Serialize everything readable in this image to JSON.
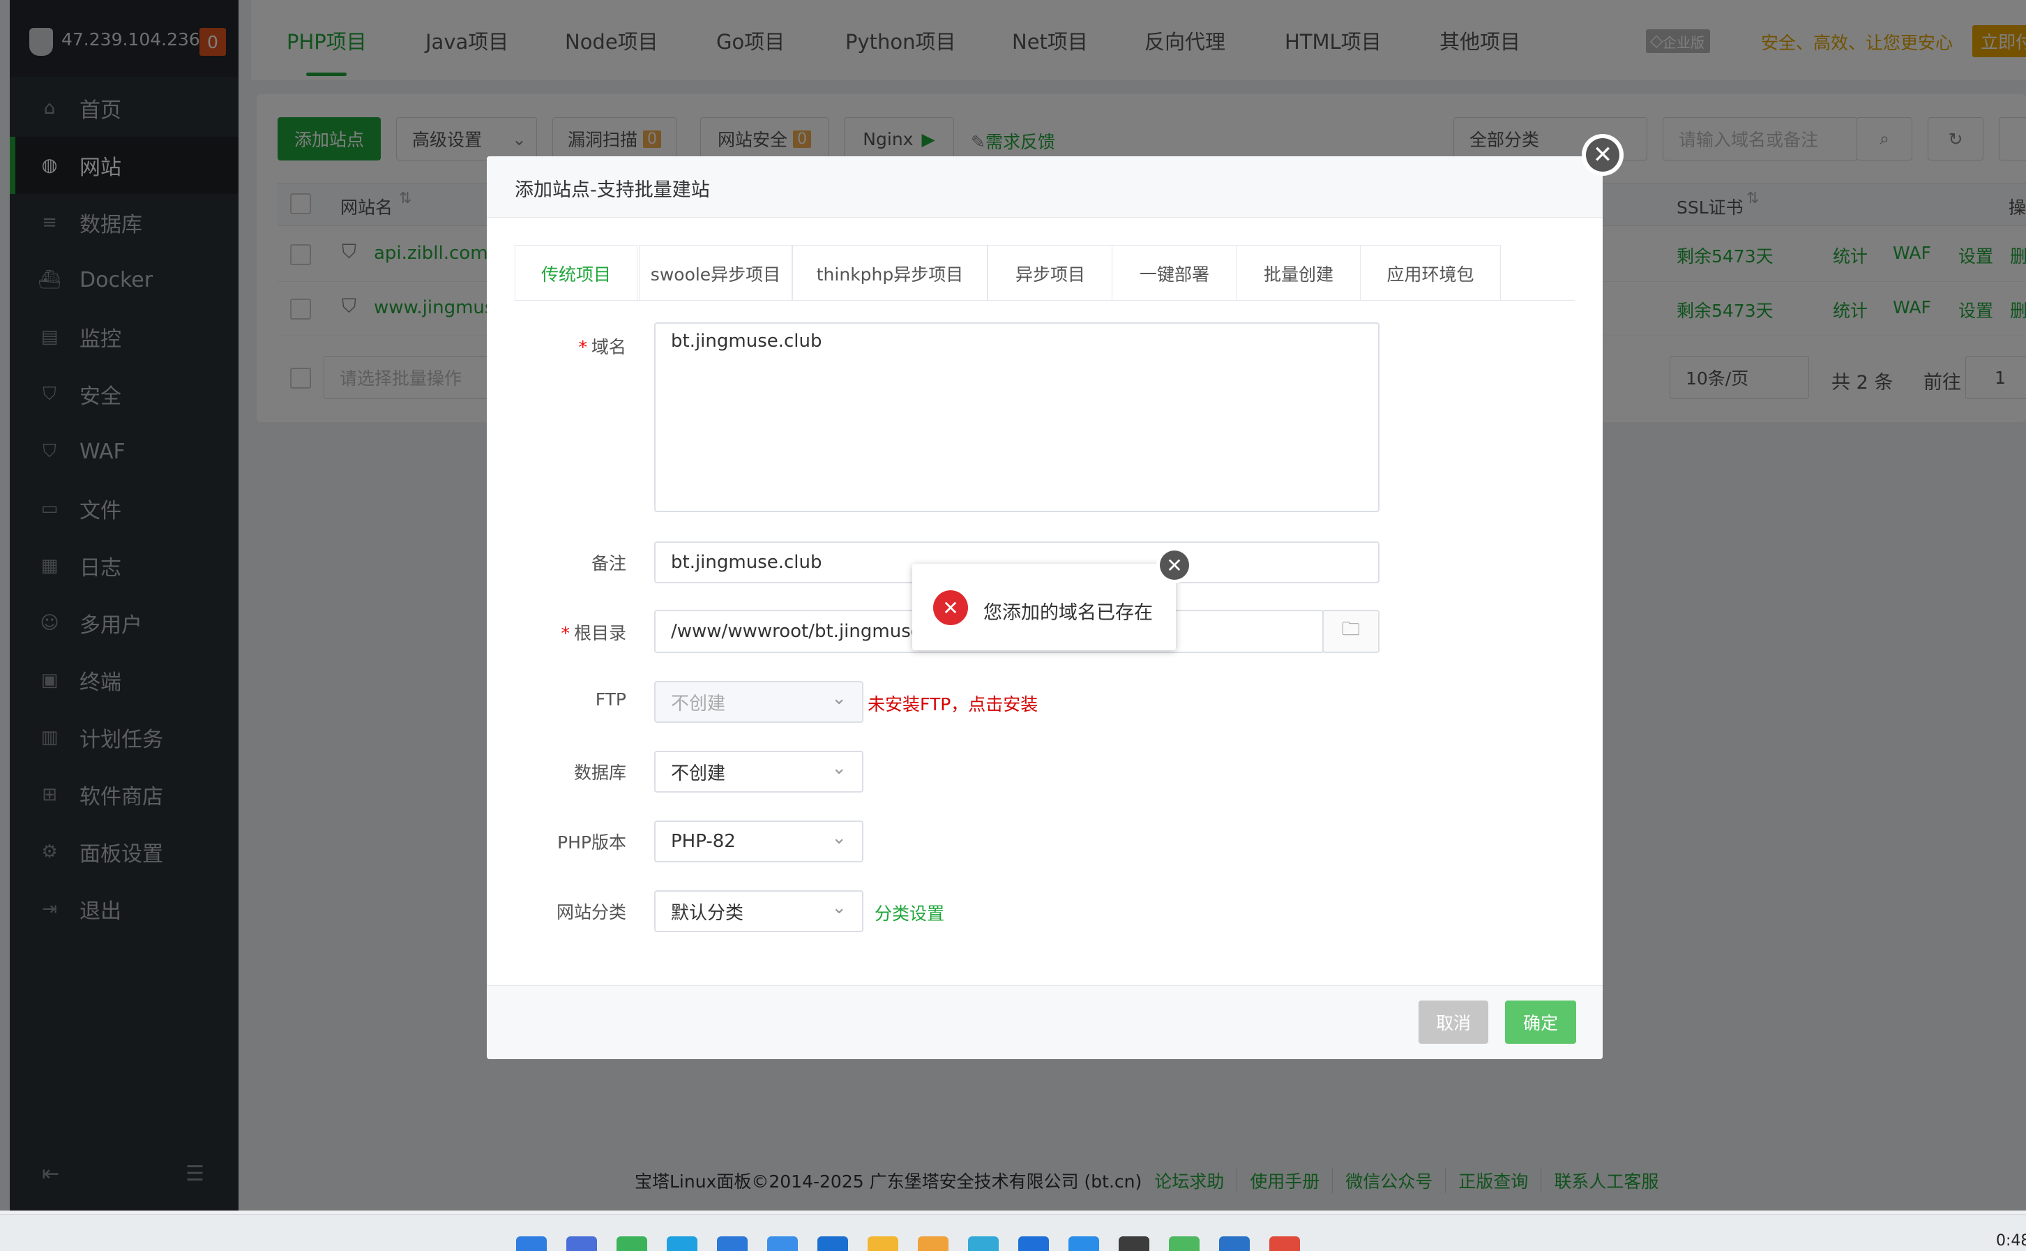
{
  "server": {
    "ip": "47.239.104.236",
    "alert_count": "0"
  },
  "sidebar": {
    "items": [
      {
        "label": "首页",
        "icon": "home-icon"
      },
      {
        "label": "网站",
        "icon": "globe-icon"
      },
      {
        "label": "数据库",
        "icon": "database-icon"
      },
      {
        "label": "Docker",
        "icon": "docker-icon"
      },
      {
        "label": "监控",
        "icon": "monitor-icon"
      },
      {
        "label": "安全",
        "icon": "shield-icon"
      },
      {
        "label": "WAF",
        "icon": "waf-icon"
      },
      {
        "label": "文件",
        "icon": "folder-icon"
      },
      {
        "label": "日志",
        "icon": "log-icon"
      },
      {
        "label": "多用户",
        "icon": "users-icon"
      },
      {
        "label": "终端",
        "icon": "terminal-icon"
      },
      {
        "label": "计划任务",
        "icon": "calendar-icon"
      },
      {
        "label": "软件商店",
        "icon": "grid-icon"
      },
      {
        "label": "面板设置",
        "icon": "gear-icon"
      },
      {
        "label": "退出",
        "icon": "logout-icon"
      }
    ],
    "active_index": 1
  },
  "top_tabs": [
    "PHP项目",
    "Java项目",
    "Node项目",
    "Go项目",
    "Python项目",
    "Net项目",
    "反向代理",
    "HTML项目",
    "其他项目"
  ],
  "enterprise": {
    "badge": "企业版",
    "slogan": "安全、高效、让您更安心",
    "buy": "立即付"
  },
  "toolbar": {
    "add_site": "添加站点",
    "advanced": "高级设置",
    "vuln_scan": "漏洞扫描",
    "vuln_count": "0",
    "site_security": "网站安全",
    "security_count": "0",
    "nginx": "Nginx",
    "feedback": "需求反馈",
    "category": "全部分类",
    "search_placeholder": "请输入域名或备注"
  },
  "table": {
    "col_name": "网站名",
    "col_ssl": "SSL证书",
    "col_op": "操",
    "rows": [
      {
        "name": "api.zibll.com",
        "ssl": "剩余5473天"
      },
      {
        "name": "www.jingmuse",
        "ssl": "剩余5473天"
      }
    ],
    "actions": [
      "统计",
      "WAF",
      "设置",
      "删"
    ],
    "batch_placeholder": "请选择批量操作",
    "page_size": "10条/页",
    "total": "共 2 条",
    "goto": "前往",
    "page": "1"
  },
  "modal": {
    "title": "添加站点-支持批量建站",
    "tabs": [
      "传统项目",
      "swoole异步项目",
      "thinkphp异步项目",
      "异步项目",
      "一键部署",
      "批量创建",
      "应用环境包"
    ],
    "domain_label": "域名",
    "domain_value": "bt.jingmuse.club",
    "note_label": "备注",
    "note_value": "bt.jingmuse.club",
    "root_label": "根目录",
    "root_value": "/www/wwwroot/bt.jingmuse.cl",
    "ftp_label": "FTP",
    "ftp_value": "不创建",
    "ftp_warning": "未安装FTP，点击安装",
    "db_label": "数据库",
    "db_value": "不创建",
    "php_label": "PHP版本",
    "php_value": "PHP-82",
    "cat_label": "网站分类",
    "cat_value": "默认分类",
    "cat_link": "分类设置",
    "cancel": "取消",
    "confirm": "确定"
  },
  "toast": {
    "message": "您添加的域名已存在"
  },
  "footer": {
    "copyright": "宝塔Linux面板©2014-2025 广东堡塔安全技术有限公司 (bt.cn)",
    "links": [
      "论坛求助",
      "使用手册",
      "微信公众号",
      "正版查询",
      "联系人工客服"
    ]
  },
  "clock": "0:48",
  "colors": {
    "brand": "#20a53a",
    "error": "#e0292f",
    "warning_text": "#d40000"
  }
}
